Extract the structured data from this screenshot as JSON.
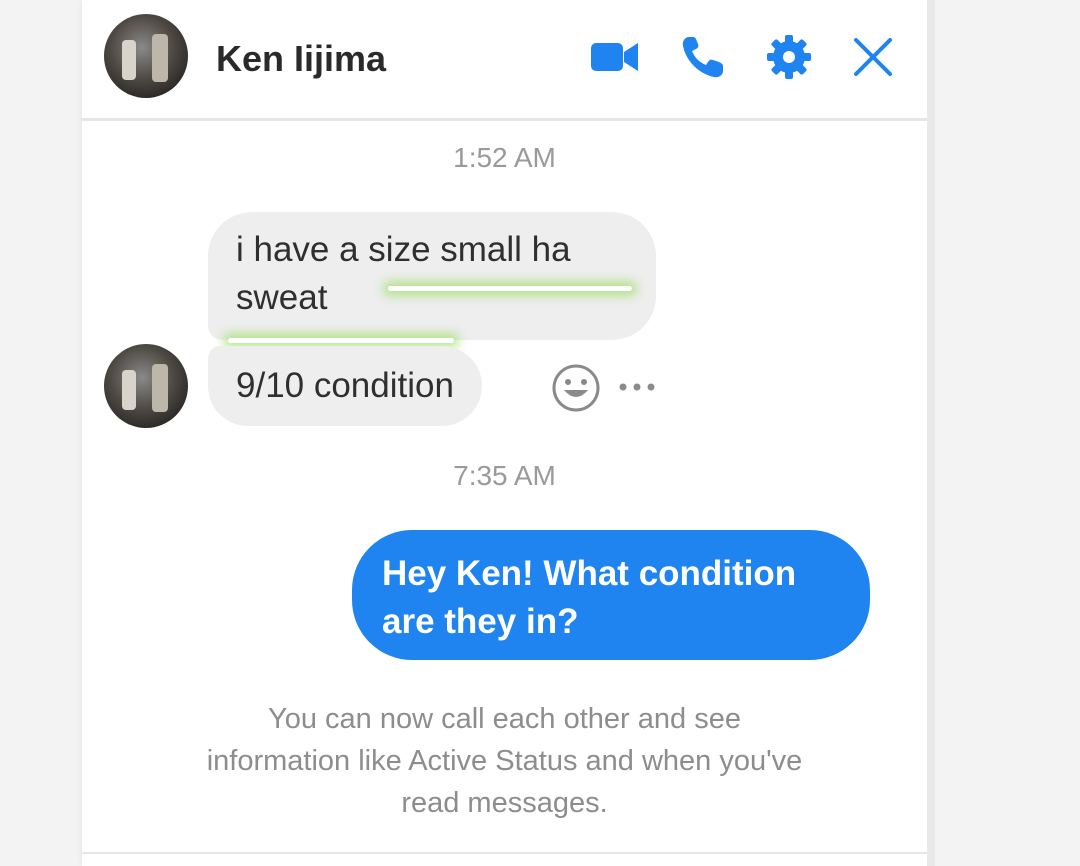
{
  "header": {
    "contact_name": "Ken Iijima",
    "icons": [
      "video-camera-icon",
      "phone-icon",
      "gear-icon",
      "close-icon"
    ]
  },
  "conversation": {
    "timestamp_1": "1:52 AM",
    "incoming_1_line1": "i have a size small ha",
    "incoming_1_line2": "sweat",
    "incoming_2": "9/10 condition",
    "timestamp_2": "7:35 AM",
    "outgoing_1_line1": "Hey Ken! What condition",
    "outgoing_1_line2": "are they in?",
    "notice_line1": "You can now call each other and see",
    "notice_line2": "information like Active Status and when you've",
    "notice_line3": "read messages."
  },
  "colors": {
    "accent": "#1f84f0",
    "incoming_bubble": "#eeeeee",
    "timestamp_text": "#9a9a9a",
    "highlight_glow": "#96dc5a"
  }
}
